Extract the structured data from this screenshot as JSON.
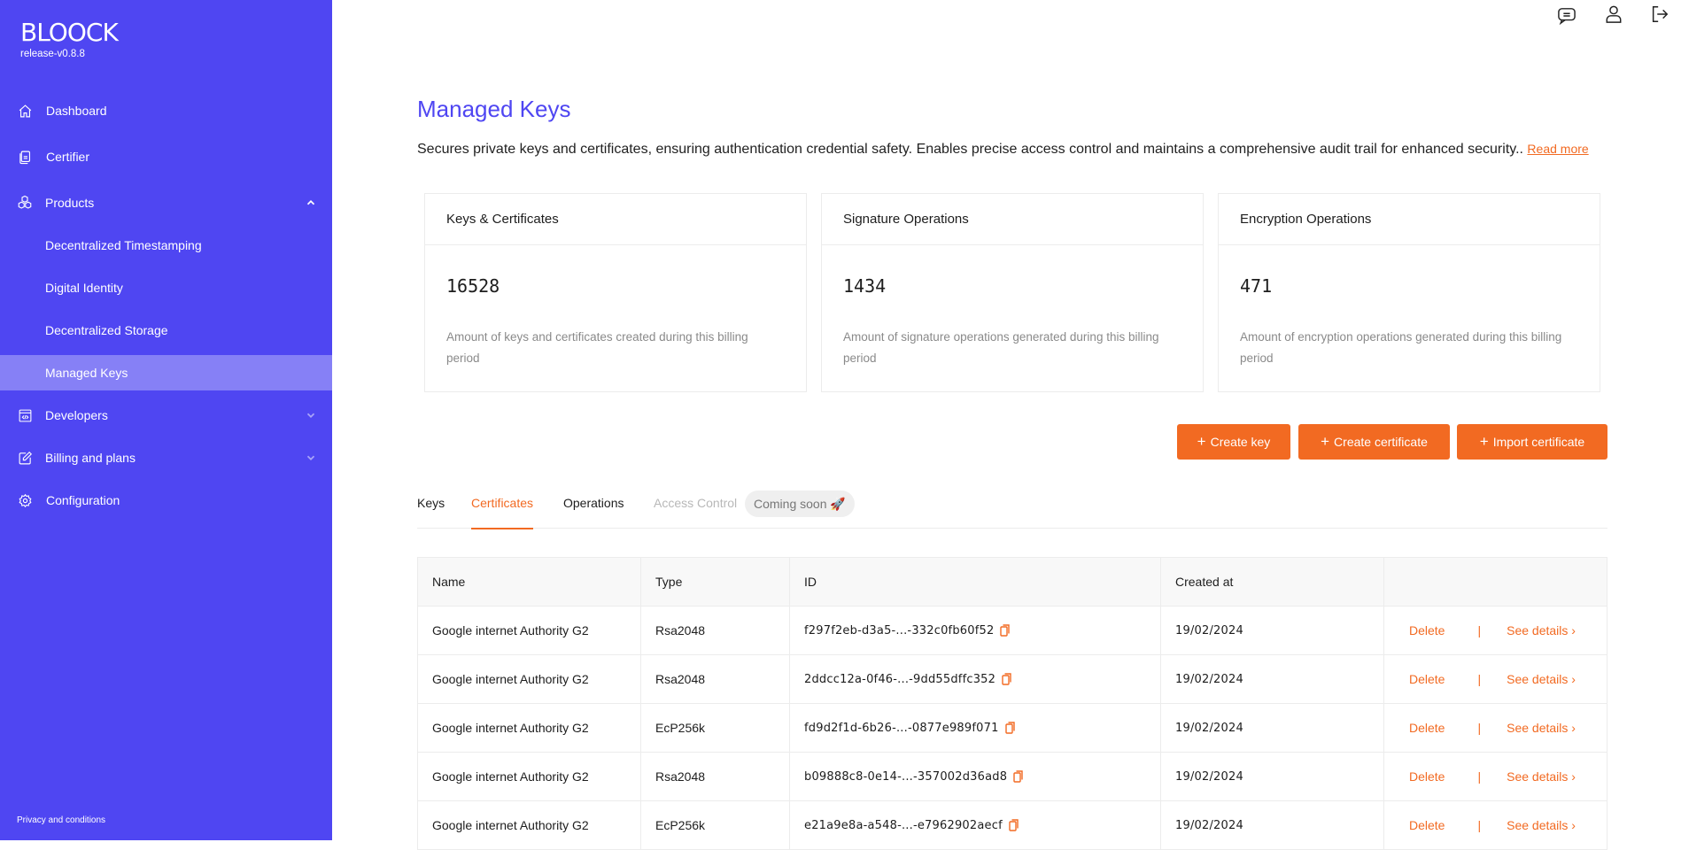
{
  "app": {
    "logo": "BLOOCK",
    "version": "release-v0.8.8"
  },
  "sidebar": {
    "items": [
      {
        "label": "Dashboard",
        "icon": "home-icon"
      },
      {
        "label": "Certifier",
        "icon": "document-icon"
      },
      {
        "label": "Products",
        "icon": "cubes-icon",
        "expanded": true
      },
      {
        "label": "Decentralized Timestamping"
      },
      {
        "label": "Digital Identity"
      },
      {
        "label": "Decentralized Storage"
      },
      {
        "label": "Managed Keys",
        "active": true
      },
      {
        "label": "Developers",
        "icon": "code-window-icon",
        "expanded": false
      },
      {
        "label": "Billing and plans",
        "icon": "edit-icon",
        "expanded": false
      },
      {
        "label": "Configuration",
        "icon": "gear-icon"
      }
    ],
    "footer": "Privacy and conditions"
  },
  "topbar": {
    "icons": [
      "chat-icon",
      "user-icon",
      "logout-icon"
    ]
  },
  "page": {
    "title": "Managed Keys",
    "description": "Secures private keys and certificates, ensuring authentication credential safety. Enables precise access control and maintains a comprehensive audit trail for enhanced security..",
    "read_more": "Read more"
  },
  "stats": [
    {
      "title": "Keys & Certificates",
      "value": "16528",
      "desc": "Amount of keys and certificates created during this billing period"
    },
    {
      "title": "Signature Operations",
      "value": "1434",
      "desc": "Amount of signature operations generated during this billing period"
    },
    {
      "title": "Encryption Operations",
      "value": "471",
      "desc": "Amount of encryption operations generated during this billing period"
    }
  ],
  "actions": {
    "create_key": "Create key",
    "create_certificate": "Create certificate",
    "import_certificate": "Import certificate"
  },
  "tabs": {
    "keys": "Keys",
    "certificates": "Certificates",
    "operations": "Operations",
    "access_control": "Access Control",
    "coming_soon": "Coming soon 🚀",
    "active": "Certificates"
  },
  "table": {
    "columns": [
      "Name",
      "Type",
      "ID",
      "Created at",
      ""
    ],
    "rows": [
      {
        "name": "Google internet Authority G2",
        "type": "Rsa2048",
        "id": "f297f2eb-d3a5-...-332c0fb60f52",
        "created": "19/02/2024"
      },
      {
        "name": "Google internet Authority G2",
        "type": "Rsa2048",
        "id": "2ddcc12a-0f46-...-9dd55dffc352",
        "created": "19/02/2024"
      },
      {
        "name": "Google internet Authority G2",
        "type": "EcP256k",
        "id": "fd9d2f1d-6b26-...-0877e989f071",
        "created": "19/02/2024"
      },
      {
        "name": "Google internet Authority G2",
        "type": "Rsa2048",
        "id": "b09888c8-0e14-...-357002d36ad8",
        "created": "19/02/2024"
      },
      {
        "name": "Google internet Authority G2",
        "type": "EcP256k",
        "id": "e21a9e8a-a548-...-e7962902aecf",
        "created": "19/02/2024"
      }
    ],
    "delete_label": "Delete",
    "separator": "|",
    "details_label": "See details ›"
  },
  "colors": {
    "brand": "#4f46f2",
    "accent": "#f26a22",
    "sidebar_active": "#8680f6"
  }
}
